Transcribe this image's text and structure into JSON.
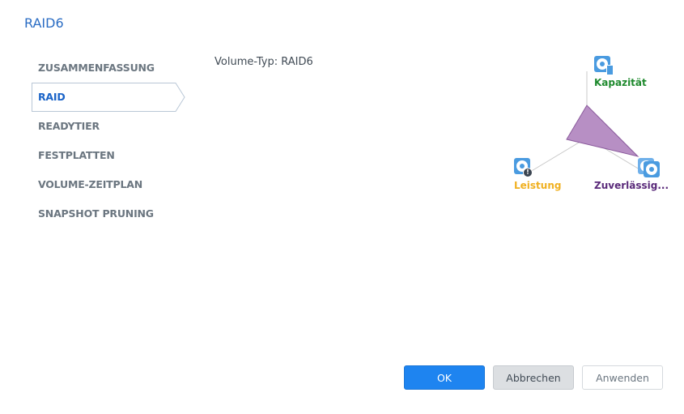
{
  "dialog": {
    "title": "RAID6"
  },
  "nav": {
    "items": [
      {
        "label": "ZUSAMMENFASSUNG",
        "active": false
      },
      {
        "label": "RAID",
        "active": true
      },
      {
        "label": "READYTIER",
        "active": false
      },
      {
        "label": "FESTPLATTEN",
        "active": false
      },
      {
        "label": "VOLUME-ZEITPLAN",
        "active": false
      },
      {
        "label": "SNAPSHOT PRUNING",
        "active": false
      }
    ]
  },
  "content": {
    "volume_type": "Volume-Typ: RAID6"
  },
  "radar": {
    "axes": [
      {
        "label": "Kapazität",
        "color": "#1f8a2e",
        "icon": "disk-capacity-icon"
      },
      {
        "label": "Leistung",
        "color": "#f0b020",
        "icon": "disk-performance-icon"
      },
      {
        "label": "Zuverlässig...",
        "color": "#5a2a7a",
        "icon": "disk-reliability-icon"
      }
    ],
    "fill_color": "#b78fc4",
    "stroke_color": "#8a5a9c"
  },
  "buttons": {
    "ok": "OK",
    "cancel": "Abbrechen",
    "apply": "Anwenden"
  }
}
